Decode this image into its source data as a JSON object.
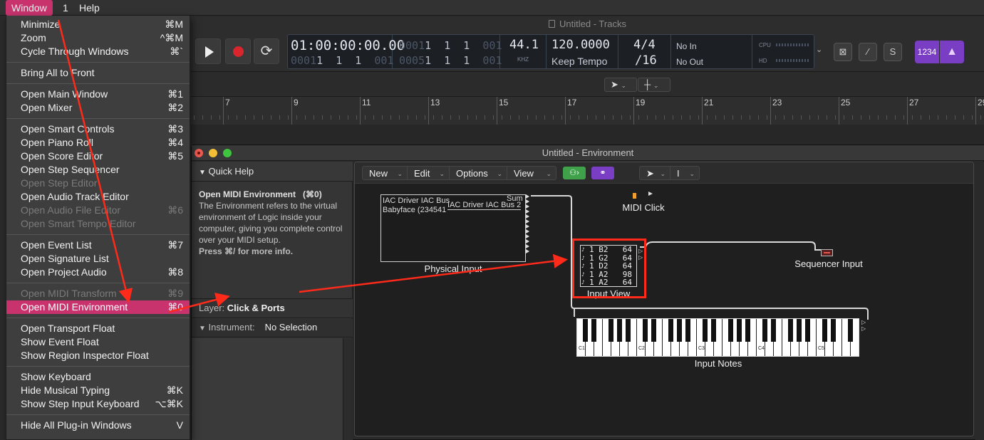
{
  "menubar": {
    "window": "Window",
    "one": "1",
    "help": "Help"
  },
  "tracks_window": {
    "title": "Untitled - Tracks"
  },
  "lcd": {
    "time_code": "01:00:00:00.00",
    "time_code_sub_dim": "0001",
    "time_code_sub_rest": "1  1  1  ",
    "time_code_sub_tail": "001",
    "position": "0001",
    "position_rest": "1  1  1  ",
    "position_tail": "001",
    "end_dim": "0005",
    "end_rest": "1  1  1  ",
    "end_tail": "001",
    "sample_rate": "44.1",
    "sample_rate_unit": "KHZ",
    "tempo": "120.0000",
    "tempo_mode": "Keep Tempo",
    "time_sig": "4/4",
    "division": "/16",
    "midi_in": "No In",
    "midi_out": "No Out",
    "cpu_label": "CPU",
    "hd_label": "HD"
  },
  "toolbar_right": {
    "s_button": "S",
    "count_in": "1234",
    "metronome_icon": "metronome-icon"
  },
  "ruler": {
    "bars": [
      "7",
      "9",
      "11",
      "13",
      "15",
      "17",
      "19",
      "21",
      "23",
      "25",
      "27",
      "29"
    ]
  },
  "environment": {
    "title": "Untitled - Environment",
    "quick_help": {
      "header": "Quick Help",
      "heading": "Open MIDI Environment",
      "heading_shortcut": "(⌘0)",
      "body": "The Environment refers to the virtual environment of Logic inside your computer, giving you complete control over your MIDI setup.",
      "more": "Press ⌘/ for more info."
    },
    "layer": {
      "label": "Layer:",
      "value": "Click & Ports"
    },
    "instrument": {
      "label": "Instrument:",
      "value": "No Selection"
    },
    "menu": {
      "new": "New",
      "edit": "Edit",
      "options": "Options",
      "view": "View"
    },
    "objects": {
      "physical_input": {
        "label": "Physical Input",
        "line1": "IAC Driver IAC Bus",
        "line2": "Babyface (234541",
        "sum": "Sum",
        "bus2": "IAC Driver IAC Bus 2"
      },
      "midi_click": {
        "label": "MIDI Click"
      },
      "input_view": {
        "label": "Input View",
        "rows": [
          {
            "note": "1 B2",
            "value": "64"
          },
          {
            "note": "1 G2",
            "value": "64"
          },
          {
            "note": "1 D2",
            "value": "64"
          },
          {
            "note": "1 A2",
            "value": "98"
          },
          {
            "note": "1 A2",
            "value": "64"
          }
        ]
      },
      "sequencer_input": {
        "label": "Sequencer Input"
      },
      "input_notes": {
        "label": "Input Notes",
        "octaves": [
          "C1",
          "C2",
          "C3",
          "C4",
          "C5"
        ]
      }
    }
  },
  "window_menu": {
    "groups": [
      [
        {
          "label": "Minimize",
          "shortcut": "⌘M",
          "enabled": true
        },
        {
          "label": "Zoom",
          "shortcut": "^⌘M",
          "enabled": true
        },
        {
          "label": "Cycle Through Windows",
          "shortcut": "⌘`",
          "enabled": true
        }
      ],
      [
        {
          "label": "Bring All to Front",
          "shortcut": "",
          "enabled": true
        }
      ],
      [
        {
          "label": "Open Main Window",
          "shortcut": "⌘1",
          "enabled": true
        },
        {
          "label": "Open Mixer",
          "shortcut": "⌘2",
          "enabled": true
        }
      ],
      [
        {
          "label": "Open Smart Controls",
          "shortcut": "⌘3",
          "enabled": true
        },
        {
          "label": "Open Piano Roll",
          "shortcut": "⌘4",
          "enabled": true
        },
        {
          "label": "Open Score Editor",
          "shortcut": "⌘5",
          "enabled": true
        },
        {
          "label": "Open Step Sequencer",
          "shortcut": "",
          "enabled": true
        },
        {
          "label": "Open Step Editor",
          "shortcut": "",
          "enabled": false
        },
        {
          "label": "Open Audio Track Editor",
          "shortcut": "",
          "enabled": true
        },
        {
          "label": "Open Audio File Editor",
          "shortcut": "⌘6",
          "enabled": false
        },
        {
          "label": "Open Smart Tempo Editor",
          "shortcut": "",
          "enabled": false
        }
      ],
      [
        {
          "label": "Open Event List",
          "shortcut": "⌘7",
          "enabled": true
        },
        {
          "label": "Open Signature List",
          "shortcut": "",
          "enabled": true
        },
        {
          "label": "Open Project Audio",
          "shortcut": "⌘8",
          "enabled": true
        }
      ],
      [
        {
          "label": "Open MIDI Transform",
          "shortcut": "⌘9",
          "enabled": false
        },
        {
          "label": "Open MIDI Environment",
          "shortcut": "⌘0",
          "enabled": true,
          "highlighted": true
        }
      ],
      [
        {
          "label": "Open Transport Float",
          "shortcut": "",
          "enabled": true
        },
        {
          "label": "Show Event Float",
          "shortcut": "",
          "enabled": true
        },
        {
          "label": "Show Region Inspector Float",
          "shortcut": "",
          "enabled": true
        }
      ],
      [
        {
          "label": "Show Keyboard",
          "shortcut": "",
          "enabled": true
        },
        {
          "label": "Hide Musical Typing",
          "shortcut": "⌘K",
          "enabled": true
        },
        {
          "label": "Show Step Input Keyboard",
          "shortcut": "⌥⌘K",
          "enabled": true
        }
      ],
      [
        {
          "label": "Hide All Plug-in Windows",
          "shortcut": "V",
          "enabled": true
        }
      ]
    ]
  },
  "colors": {
    "menu_highlight": "#c8336e",
    "annotation": "#ff2a1a",
    "count_in": "#7a3ec4"
  }
}
